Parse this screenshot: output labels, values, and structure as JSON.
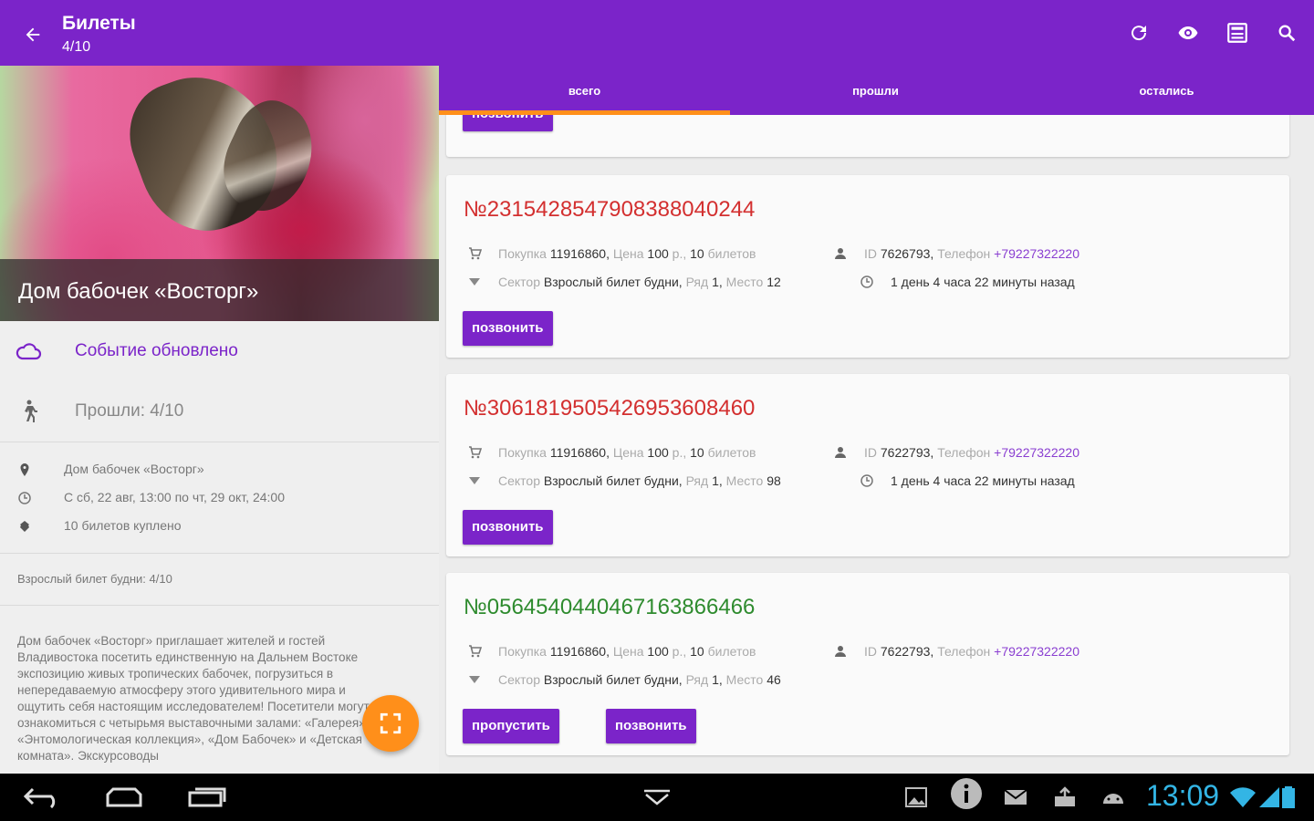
{
  "appbar": {
    "title": "Билеты",
    "subtitle": "4/10",
    "icons": [
      "back-arrow-icon",
      "refresh-icon",
      "eye-icon",
      "ticket-scanner-icon",
      "search-icon"
    ],
    "color": "#7b24c9"
  },
  "event": {
    "title": "Дом бабочек «Восторг»",
    "status": "Событие обновлено",
    "passed": "Прошли: 4/10",
    "location": "Дом бабочек «Восторг»",
    "dates": "С сб, 22 авг, 13:00 по чт, 29 окт, 24:00",
    "tickets_bought": "10 билетов куплено",
    "ticket_type_summary": "Взрослый билет будни: 4/10",
    "description": "Дом бабочек «Восторг» приглашает жителей и гостей Владивостока посетить единственную на Дальнем Востоке экспозицию живых тропических бабочек, погрузиться в непередаваемую атмосферу этого удивительного мира и ощутить себя настоящим исследователем! Посетители могут ознакомиться с четырьмя выставочными залами: «Галерея», «Энтомологическая коллекция», «Дом Бабочек» и «Детская комната». Экскурсоводы"
  },
  "tabs": [
    {
      "label": "Всего",
      "active": true
    },
    {
      "label": "Прошли",
      "active": false
    },
    {
      "label": "Остались",
      "active": false
    }
  ],
  "labels": {
    "purchase": "Покупка",
    "price": "Цена",
    "rub": "р.,",
    "tickets_word": "билетов",
    "id": "ID",
    "phone": "Телефон",
    "sector": "Сектор",
    "row": "Ряд",
    "seat": "Место",
    "call_button": "Позвонить",
    "skip_button": "Пропустить"
  },
  "tickets": [
    {
      "number": "№23154285479083880402​44",
      "status_color": "#d32f2f",
      "purchase_id": "11916860",
      "price": "100",
      "count": "10",
      "user_id": "7626793",
      "phone": "+79227322220",
      "sector": "Взрослый билет будни",
      "row": "1",
      "seat": "12",
      "time_ago": "1 день 4 часа 22 минуты назад"
    },
    {
      "number": "№30618195054269536084​60",
      "status_color": "#d32f2f",
      "purchase_id": "11916860",
      "price": "100",
      "count": "10",
      "user_id": "7622793",
      "phone": "+79227322220",
      "sector": "Взрослый билет будни",
      "row": "1",
      "seat": "98",
      "time_ago": "1 день 4 часа 22 минуты назад"
    },
    {
      "number": "№05645404404671638664​66",
      "status_color": "#2e8b2e",
      "purchase_id": "11916860",
      "price": "100",
      "count": "10",
      "user_id": "7622793",
      "phone": "+79227322220",
      "sector": "Взрослый билет будни",
      "row": "1",
      "seat": "46",
      "time_ago": ""
    }
  ],
  "system": {
    "time": "13:09",
    "accent": "#ff8f1a"
  }
}
